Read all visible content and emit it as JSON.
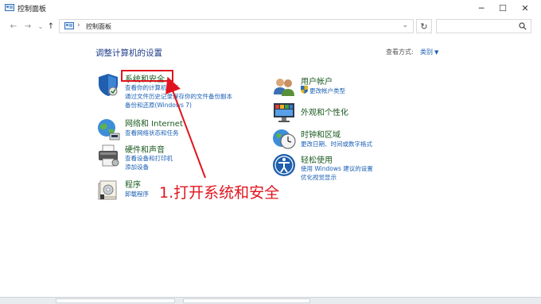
{
  "window": {
    "title": "控制面板",
    "minimize_glyph": "─",
    "maximize_glyph": "☐",
    "close_glyph": "✕"
  },
  "nav": {
    "back_glyph": "←",
    "forward_glyph": "→",
    "recent_glyph": "⌄",
    "up_glyph": "↑",
    "breadcrumb": "控制面板",
    "breadcrumb_sep": "›",
    "address_dropdown_glyph": "⌄",
    "refresh_glyph": "↻",
    "search_placeholder": ""
  },
  "main": {
    "heading": "调整计算机的设置",
    "view_by_label": "查看方式:",
    "view_by_value": "类别",
    "view_by_arrow": "▼"
  },
  "categories_left": [
    {
      "title": "系统和安全",
      "links": [
        "查看你的计算机状态",
        "通过文件历史记录保存你的文件备份副本",
        "备份和还原(Windows 7)"
      ],
      "icon": "shield-icon"
    },
    {
      "title": "网络和 Internet",
      "links": [
        "查看网络状态和任务"
      ],
      "icon": "network-globe-icon"
    },
    {
      "title": "硬件和声音",
      "links": [
        "查看设备和打印机",
        "添加设备"
      ],
      "icon": "printer-icon"
    },
    {
      "title": "程序",
      "links": [
        "卸载程序"
      ],
      "icon": "programs-icon"
    }
  ],
  "categories_right": [
    {
      "title": "用户帐户",
      "links": [
        "更改帐户类型"
      ],
      "icon": "users-icon"
    },
    {
      "title": "外观和个性化",
      "links": [],
      "icon": "appearance-icon"
    },
    {
      "title": "时钟和区域",
      "links": [
        "更改日期、时间或数字格式"
      ],
      "icon": "clock-icon"
    },
    {
      "title": "轻松使用",
      "links": [
        "使用 Windows 建议的设置",
        "优化视觉显示"
      ],
      "icon": "accessibility-icon"
    }
  ],
  "annotation": {
    "text": "1.打开系统和安全"
  },
  "colors": {
    "accent_link": "#1a5fb4",
    "category_title": "#1a5a1f",
    "annotation_red": "#e0141e",
    "heading": "#1f3c88"
  }
}
